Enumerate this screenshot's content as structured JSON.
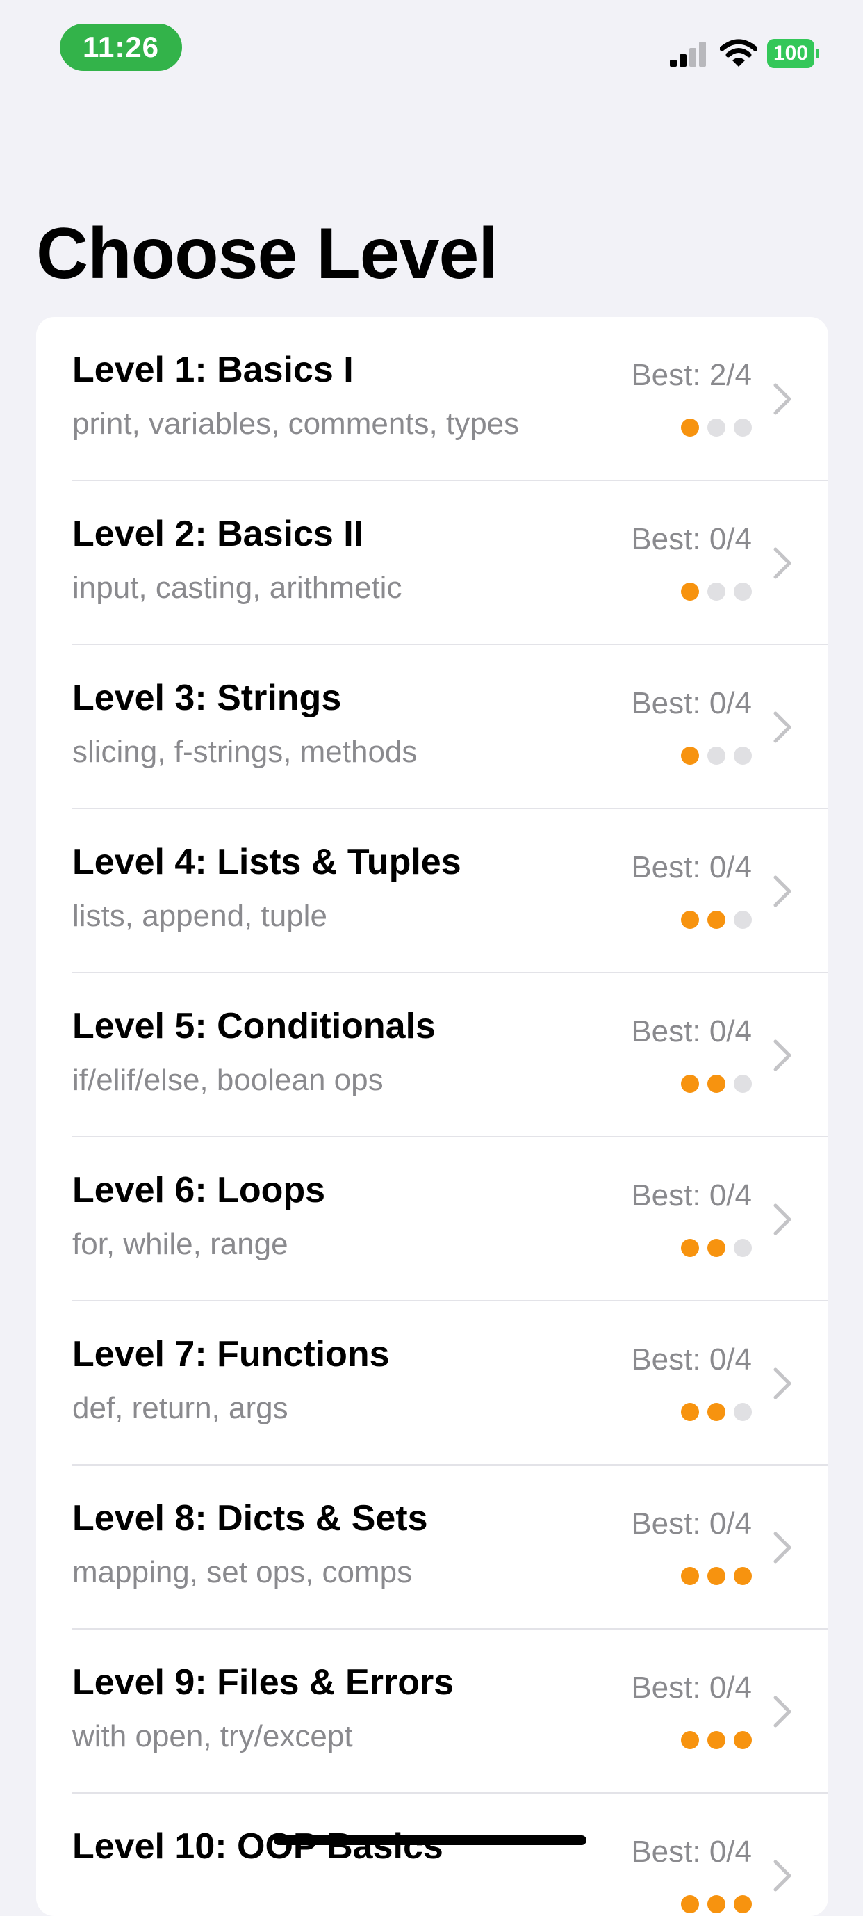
{
  "status_bar": {
    "time": "11:26",
    "battery": "100",
    "icons": [
      "signal-icon",
      "wifi-icon",
      "battery-icon"
    ]
  },
  "page": {
    "title": "Choose Level"
  },
  "colors": {
    "background": "#f2f2f7",
    "card": "#ffffff",
    "accent": "#f7930f",
    "time_pill": "#33b34a",
    "battery": "#34c759",
    "secondary_text": "#8a8a8e"
  },
  "levels": [
    {
      "title": "Level 1: Basics I",
      "topics": "print, variables, comments, types",
      "best": "Best: 2/4",
      "difficulty": 1
    },
    {
      "title": "Level 2: Basics II",
      "topics": "input, casting, arithmetic",
      "best": "Best: 0/4",
      "difficulty": 1
    },
    {
      "title": "Level 3: Strings",
      "topics": "slicing, f-strings, methods",
      "best": "Best: 0/4",
      "difficulty": 1
    },
    {
      "title": "Level 4: Lists & Tuples",
      "topics": "lists, append, tuple",
      "best": "Best: 0/4",
      "difficulty": 2
    },
    {
      "title": "Level 5: Conditionals",
      "topics": "if/elif/else, boolean ops",
      "best": "Best: 0/4",
      "difficulty": 2
    },
    {
      "title": "Level 6: Loops",
      "topics": "for, while, range",
      "best": "Best: 0/4",
      "difficulty": 2
    },
    {
      "title": "Level 7: Functions",
      "topics": "def, return, args",
      "best": "Best: 0/4",
      "difficulty": 2
    },
    {
      "title": "Level 8: Dicts & Sets",
      "topics": "mapping, set ops, comps",
      "best": "Best: 0/4",
      "difficulty": 3
    },
    {
      "title": "Level 9: Files & Errors",
      "topics": "with open, try/except",
      "best": "Best: 0/4",
      "difficulty": 3
    },
    {
      "title": "Level 10: OOP Basics",
      "topics": "",
      "best": "Best: 0/4",
      "difficulty": 3
    }
  ]
}
